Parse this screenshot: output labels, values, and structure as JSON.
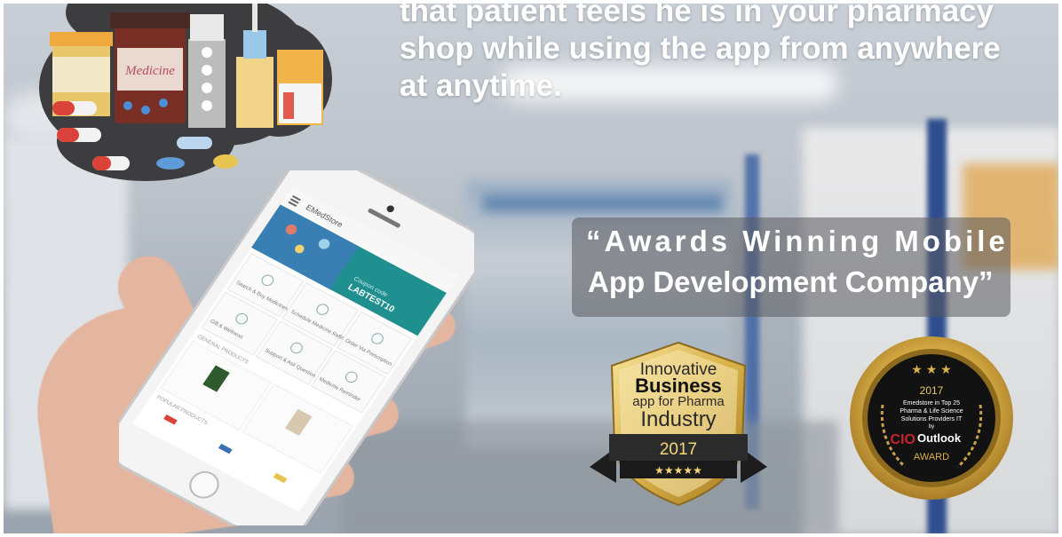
{
  "hero": {
    "line1": "that patient feels he is in your pharmacy",
    "line2": "shop while using the app from anywhere",
    "line3": "at anytime."
  },
  "tagline": {
    "line1": "“Awards Winning Mobile",
    "line2": "App Development Company”"
  },
  "illustration": {
    "bottle_label": "Medicine"
  },
  "phone_app": {
    "title": "EMedStore",
    "banner_code": "LABTEST10",
    "banner_sub": "Coupon code",
    "tiles": [
      "Search & Buy Medicines",
      "Schedule Medicine Refill",
      "Order Via Prescription",
      "Gift & Wellness",
      "Support & Ask Question",
      "Medicine Reminder"
    ],
    "section1": "GENERAL PRODUCTS",
    "section2": "POPULAR PRODUCTS"
  },
  "badge_innovative": {
    "line1": "Innovative",
    "line2": "Business",
    "line3": "app for Pharma",
    "line4": "Industry",
    "year": "2017",
    "stars": "★★★★★"
  },
  "badge_cio": {
    "year": "2017",
    "text1": "Emedstore in Top 25",
    "text2": "Pharma & Life Science",
    "text3": "Solutions Providers IT",
    "text4": "by",
    "brand_a": "CIO",
    "brand_b": "Outlook",
    "award": "AWARD",
    "stars": "★ ★ ★"
  },
  "colors": {
    "teal": "#1f8f8f",
    "gold": "#d9b24a",
    "dark": "#2a2a2a",
    "cio_red": "#c8232c"
  }
}
